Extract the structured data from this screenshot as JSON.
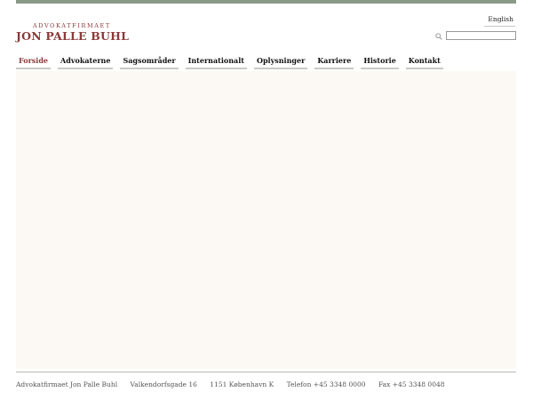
{
  "brand": {
    "tagline": "ADVOKATFIRMAET",
    "name": "JON PALLE BUHL",
    "color": "#8b3a3a"
  },
  "header": {
    "language_link": "English",
    "search": {
      "value": "",
      "placeholder": "",
      "icon": "search-icon"
    }
  },
  "nav": {
    "items": [
      {
        "label": "Forside",
        "active": true
      },
      {
        "label": "Advokaterne",
        "active": false
      },
      {
        "label": "Sagsområder",
        "active": false
      },
      {
        "label": "Internationalt",
        "active": false
      },
      {
        "label": "Oplysninger",
        "active": false
      },
      {
        "label": "Karriere",
        "active": false
      },
      {
        "label": "Historie",
        "active": false
      },
      {
        "label": "Kontakt",
        "active": false
      }
    ]
  },
  "footer": {
    "company": "Advokatfirmaet Jon Palle Buhl",
    "street": "Valkendorfsgade 16",
    "city": "1151 København K",
    "phone": "Telefon +45 3348 0000",
    "fax": "Fax +45 3348 0048"
  },
  "colors": {
    "top_bar": "#8a9a86",
    "content_bg": "#fcf9f4",
    "accent": "#8b3a3a"
  }
}
